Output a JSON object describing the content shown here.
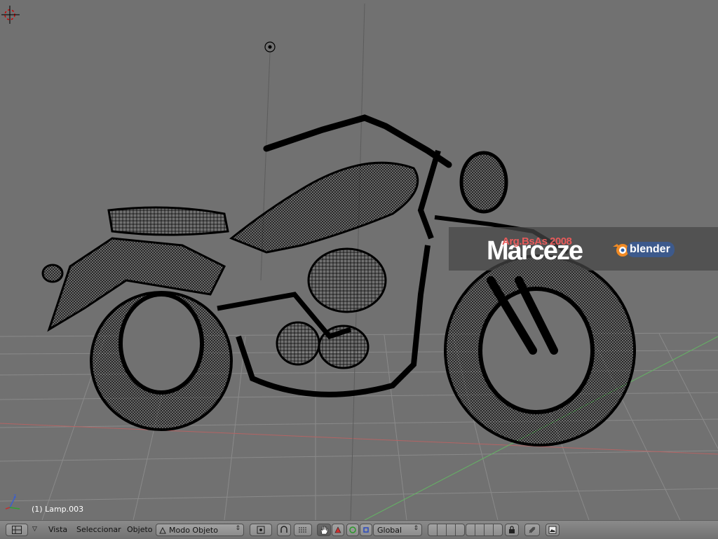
{
  "viewport": {
    "object_label": "(1) Lamp.003",
    "watermark": {
      "subtitle": "Arg.BsAs 2008",
      "name": "Marceze",
      "logo": "blender"
    }
  },
  "header": {
    "menus": {
      "view": "Vista",
      "select": "Seleccionar",
      "object": "Objeto"
    },
    "mode_select": {
      "value": "Modo Objeto"
    },
    "orientation_select": {
      "value": "Global"
    }
  },
  "icons": [
    "3d-cursor-icon",
    "lamp-icon",
    "axis-icon",
    "editor-type-icon",
    "pivot-icon",
    "snap-icon",
    "hand-icon",
    "translate-icon",
    "rotate-icon",
    "scale-icon",
    "lock-icon",
    "render-icon",
    "image-icon"
  ]
}
